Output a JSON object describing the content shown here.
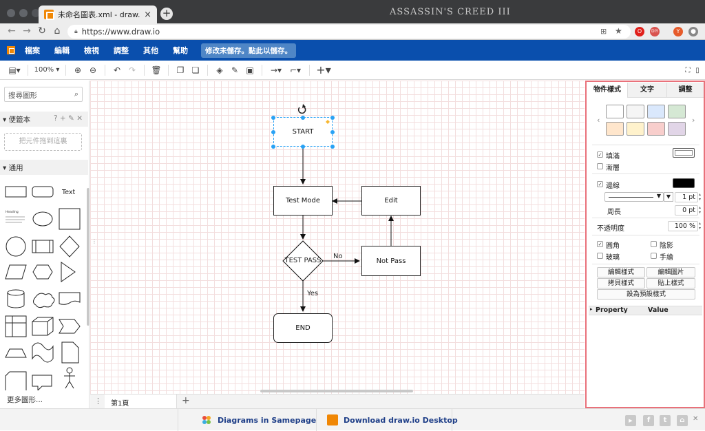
{
  "browser": {
    "tab_title": "未命名圖表.xml - draw.io",
    "tab_close": "×",
    "new_tab": "+",
    "brand_text": "ASSASSIN'S CREED III",
    "url": "https://www.draw.io",
    "ext_labels": [
      "O",
      "DIY",
      "Y"
    ]
  },
  "menubar": {
    "items": [
      "檔案",
      "編輯",
      "檢視",
      "調整",
      "其他",
      "幫助"
    ],
    "save_message": "修改未儲存。點此以儲存。"
  },
  "toolbar": {
    "zoom": "100%"
  },
  "left_panel": {
    "search_placeholder": "搜尋圖形",
    "scratchpad_title": "便籤本",
    "scratchpad_tools": "? + ✎ ✕",
    "dropzone_text": "把元件拖到這裏",
    "general_title": "通用",
    "text_shape_label": "Text",
    "heading_shape_label": "Heading",
    "more_shapes": "更多圖形..."
  },
  "diagram": {
    "nodes": {
      "start": "START",
      "test_mode": "Test Mode",
      "edit": "Edit",
      "test_pass": "TEST PASS",
      "not_pass": "Not Pass",
      "end": "END"
    },
    "edge_labels": {
      "no": "No",
      "yes": "Yes"
    }
  },
  "pages": {
    "current": "第1頁",
    "add": "+"
  },
  "right_panel": {
    "tabs": [
      "物件樣式",
      "文字",
      "調整"
    ],
    "swatch_colors": [
      [
        "#ffffff",
        "#f5f5f5",
        "#dae8fc",
        "#d5e8d4"
      ],
      [
        "#ffe6cc",
        "#fff2cc",
        "#f8cecc",
        "#e1d5e7"
      ]
    ],
    "fill_label": "填滿",
    "gradient_label": "漸層",
    "line_label": "邊線",
    "line_color": "#000000",
    "line_width": "1 pt",
    "perimeter_label": "周長",
    "perimeter_value": "0 pt",
    "opacity_label": "不透明度",
    "opacity_value": "100 %",
    "rounded_label": "圓角",
    "shadow_label": "陰影",
    "glass_label": "玻璃",
    "sketch_label": "手繪",
    "buttons": {
      "edit_style": "編輯樣式",
      "edit_image": "編輯圖片",
      "copy_style": "拷貝樣式",
      "paste_style": "貼上樣式",
      "set_default": "設為預設樣式"
    },
    "property_header": "Property",
    "value_header": "Value"
  },
  "footer": {
    "samepage": "Diagrams in Samepage",
    "desktop": "Download draw.io Desktop"
  },
  "colors": {
    "menubar_bg": "#0a4fad",
    "accent_orange": "#f08705",
    "selection_blue": "#29a2f5",
    "panel_highlight": "#e9717a"
  }
}
